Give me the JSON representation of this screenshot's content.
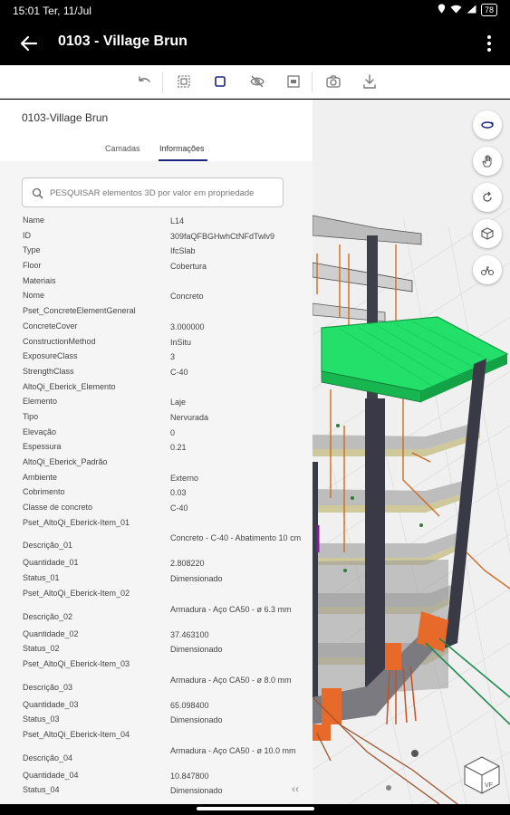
{
  "status": {
    "time": "15:01 Ter, 11/Jul",
    "battery": "78"
  },
  "appbar": {
    "title": "0103 - Village Brun"
  },
  "panel": {
    "project": "0103-Village Brun",
    "tabs": [
      {
        "label": "Camadas"
      },
      {
        "label": "Informações"
      }
    ],
    "search_placeholder": "PESQUISAR elementos 3D por valor em propriedade",
    "properties": [
      {
        "k": "Name",
        "v": "L14"
      },
      {
        "k": "ID",
        "v": "309faQFBGHwhCtNFdTwlv9"
      },
      {
        "k": "Type",
        "v": "IfcSlab"
      },
      {
        "k": "Floor",
        "v": "Cobertura"
      },
      {
        "k": "Materiais",
        "v": ""
      },
      {
        "k": "Nome",
        "v": "Concreto"
      },
      {
        "k": "Pset_ConcreteElementGeneral",
        "v": ""
      },
      {
        "k": "ConcreteCover",
        "v": "3.000000"
      },
      {
        "k": "ConstructionMethod",
        "v": "InSitu"
      },
      {
        "k": "ExposureClass",
        "v": "3"
      },
      {
        "k": "StrengthClass",
        "v": "C-40"
      },
      {
        "k": "AltoQi_Eberick_Elemento",
        "v": ""
      },
      {
        "k": "Elemento",
        "v": "Laje"
      },
      {
        "k": "Tipo",
        "v": "Nervurada"
      },
      {
        "k": "Elevação",
        "v": "0"
      },
      {
        "k": "Espessura",
        "v": "0.21"
      },
      {
        "k": "AltoQi_Eberick_Padrão",
        "v": ""
      },
      {
        "k": "Ambiente",
        "v": "Externo"
      },
      {
        "k": "Cobrimento",
        "v": "0.03"
      },
      {
        "k": "Classe de concreto",
        "v": "C-40"
      },
      {
        "k": "Pset_AltoQi_Eberick-Item_01",
        "v": ""
      },
      {
        "k": "Descrição_01",
        "v": "Concreto - C-40 - Abatimento 10 cm"
      },
      {
        "k": "Quantidade_01",
        "v": "2.808220"
      },
      {
        "k": "Status_01",
        "v": "Dimensionado"
      },
      {
        "k": "Pset_AltoQi_Eberick-Item_02",
        "v": ""
      },
      {
        "k": "Descrição_02",
        "v": "Armadura - Aço CA50 - ø 6.3 mm"
      },
      {
        "k": "Quantidade_02",
        "v": "37.463100"
      },
      {
        "k": "Status_02",
        "v": "Dimensionado"
      },
      {
        "k": "Pset_AltoQi_Eberick-Item_03",
        "v": ""
      },
      {
        "k": "Descrição_03",
        "v": "Armadura - Aço CA50 - ø 8.0 mm"
      },
      {
        "k": "Quantidade_03",
        "v": "65.098400"
      },
      {
        "k": "Status_03",
        "v": "Dimensionado"
      },
      {
        "k": "Pset_AltoQi_Eberick-Item_04",
        "v": ""
      },
      {
        "k": "Descrição_04",
        "v": "Armadura - Aço CA50 - ø 10.0 mm"
      },
      {
        "k": "Quantidade_04",
        "v": "10.847800"
      },
      {
        "k": "Status_04",
        "v": "Dimensionado"
      }
    ]
  },
  "viewer": {
    "cube_face": "VF"
  },
  "colors": {
    "accent": "#1a237e",
    "selected_slab": "#22e06a",
    "appbar": "#000000"
  }
}
